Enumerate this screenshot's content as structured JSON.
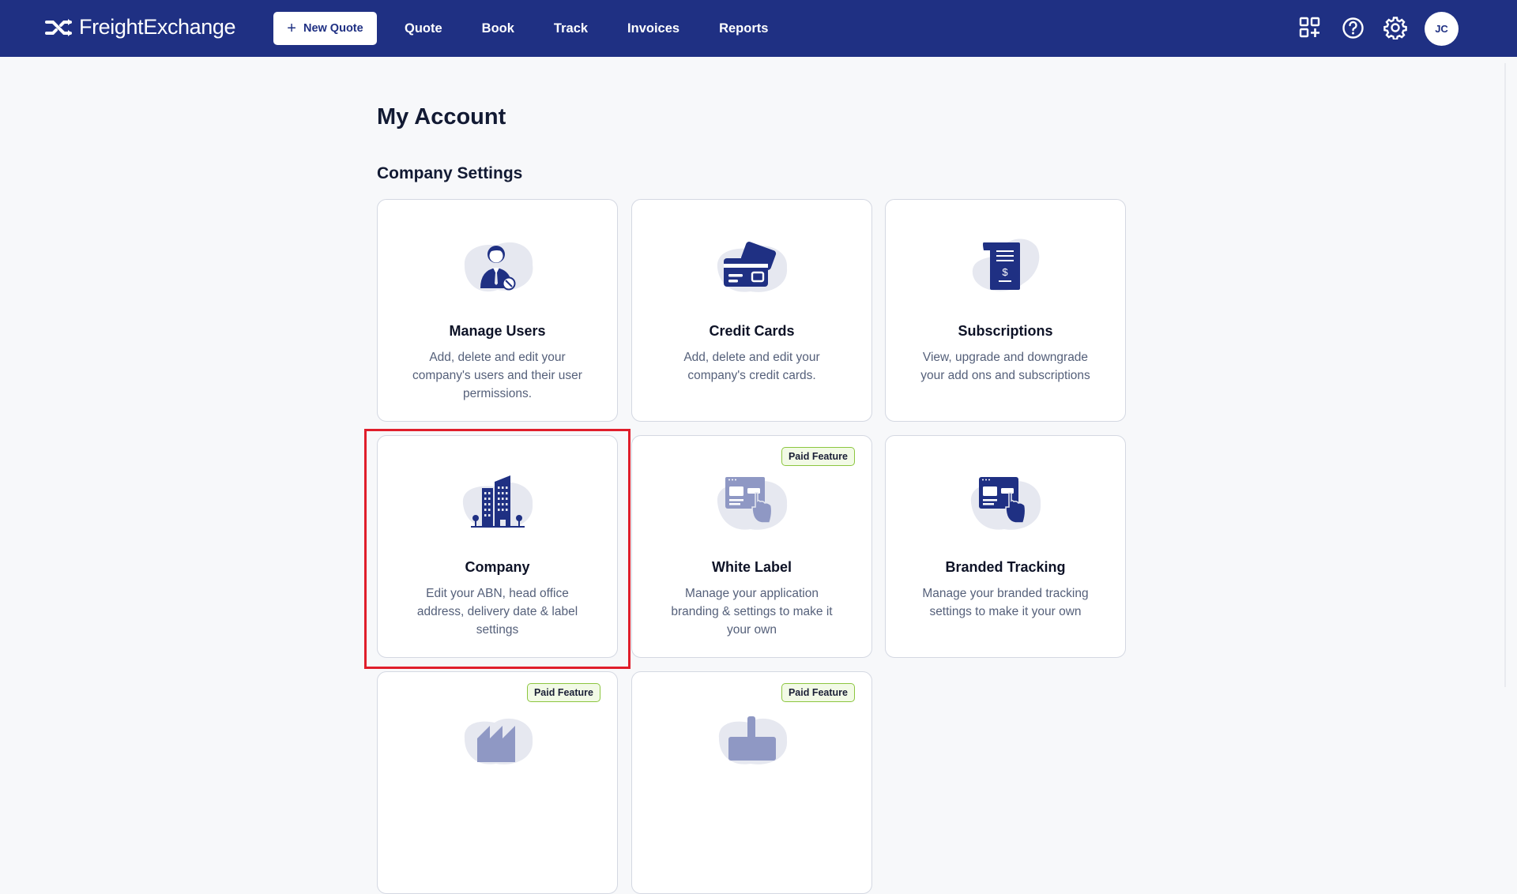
{
  "brand": {
    "name": "FreightExchange"
  },
  "header": {
    "new_quote_label": "New Quote",
    "nav": [
      "Quote",
      "Book",
      "Track",
      "Invoices",
      "Reports"
    ],
    "avatar_initials": "JC",
    "icons": [
      "apps-add-icon",
      "help-icon",
      "settings-gear-icon"
    ]
  },
  "page": {
    "title": "My Account",
    "section": "Company Settings"
  },
  "cards": [
    {
      "title": "Manage Users",
      "desc": "Add, delete and edit your company's users and their user permissions.",
      "icon": "user-icon",
      "paid": false
    },
    {
      "title": "Credit Cards",
      "desc": "Add, delete and edit your company's credit cards.",
      "icon": "credit-card-icon",
      "paid": false
    },
    {
      "title": "Subscriptions",
      "desc": "View, upgrade and downgrade your add ons and subscriptions",
      "icon": "subscription-document-icon",
      "paid": false
    },
    {
      "title": "Company",
      "desc": "Edit your ABN, head office address, delivery date & label settings",
      "icon": "company-building-icon",
      "paid": false,
      "highlighted": true
    },
    {
      "title": "White Label",
      "desc": "Manage your application branding & settings to make it your own",
      "icon": "white-label-icon",
      "paid": true
    },
    {
      "title": "Branded Tracking",
      "desc": "Manage your branded tracking settings to make it your own",
      "icon": "branded-tracking-icon",
      "paid": true
    },
    {
      "title": "",
      "desc": "",
      "icon": "warehouse-icon",
      "paid": true
    },
    {
      "title": "",
      "desc": "",
      "icon": "integration-icon",
      "paid": true
    }
  ],
  "paid_badge_label": "Paid Feature",
  "colors": {
    "header": "#1f3083",
    "accent_badge_border": "#8cc63f",
    "highlight": "#e01e2b",
    "illustration_bg": "#e6e8f0"
  }
}
